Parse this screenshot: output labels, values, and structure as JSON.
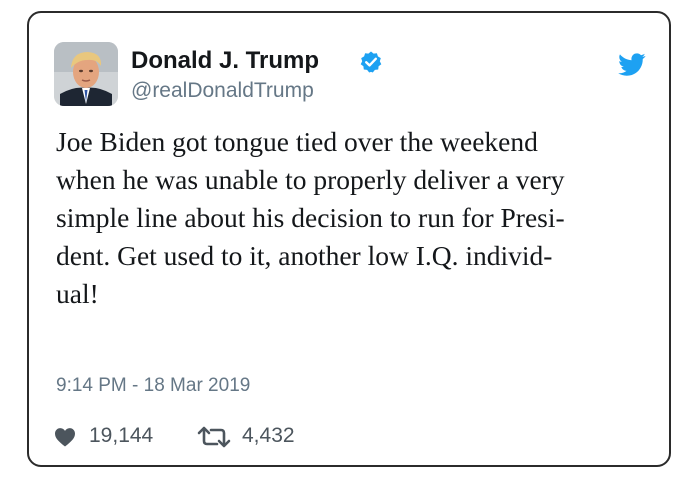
{
  "tweet": {
    "display_name": "Donald J. Trump",
    "handle": "@realDonaldTrump",
    "verified": true,
    "text_lines": [
      "Joe Biden got tongue tied over the weekend",
      "when he was unable to properly deliver a very",
      "simple line about his decision to run for Presi-",
      "dent. Get used to it, another low I.Q. individ-",
      "ual!"
    ],
    "timestamp": "9:14 PM - 18 Mar 2019",
    "likes": "19,144",
    "retweets": "4,432"
  },
  "icons": {
    "verified": "verified-badge-icon",
    "brand": "twitter-bird-icon",
    "like": "heart-icon",
    "retweet": "retweet-icon"
  },
  "colors": {
    "brand_blue": "#1da1f2",
    "text": "#14171a",
    "secondary": "#657786",
    "border": "#2b2b2b"
  }
}
